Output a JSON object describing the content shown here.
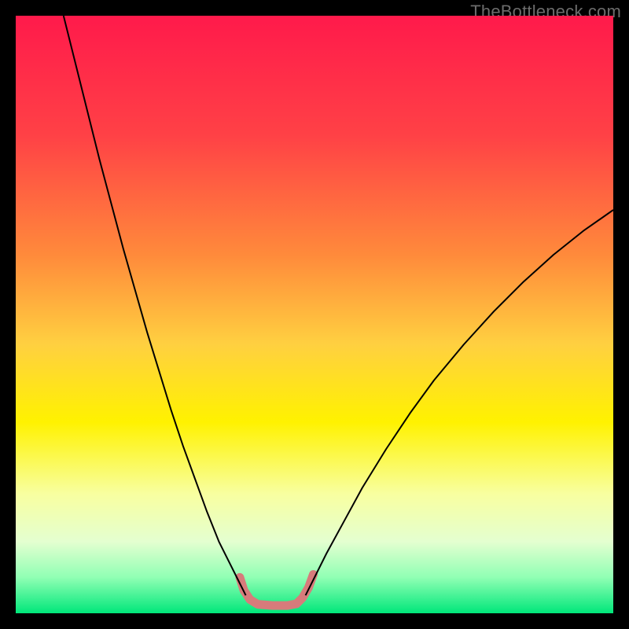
{
  "watermark": "TheBottleneck.com",
  "chart_data": {
    "type": "line",
    "title": "",
    "xlabel": "",
    "ylabel": "",
    "xlim": [
      0,
      100
    ],
    "ylim": [
      0,
      100
    ],
    "background_gradient": {
      "stops": [
        {
          "offset": 0.0,
          "color": "#ff1a4b"
        },
        {
          "offset": 0.2,
          "color": "#ff4146"
        },
        {
          "offset": 0.4,
          "color": "#ff8a3b"
        },
        {
          "offset": 0.55,
          "color": "#ffd040"
        },
        {
          "offset": 0.68,
          "color": "#fff200"
        },
        {
          "offset": 0.8,
          "color": "#f8ffa0"
        },
        {
          "offset": 0.88,
          "color": "#e4ffd0"
        },
        {
          "offset": 0.94,
          "color": "#90ffb4"
        },
        {
          "offset": 1.0,
          "color": "#00e77a"
        }
      ]
    },
    "series": [
      {
        "name": "left-curve",
        "stroke": "#000000",
        "stroke_width": 2,
        "points": [
          {
            "x": 8.0,
            "y": 100.0
          },
          {
            "x": 9.0,
            "y": 96.0
          },
          {
            "x": 10.0,
            "y": 92.0
          },
          {
            "x": 12.0,
            "y": 84.0
          },
          {
            "x": 14.0,
            "y": 76.0
          },
          {
            "x": 16.0,
            "y": 68.5
          },
          {
            "x": 18.0,
            "y": 61.0
          },
          {
            "x": 20.0,
            "y": 54.0
          },
          {
            "x": 22.0,
            "y": 47.0
          },
          {
            "x": 24.0,
            "y": 40.5
          },
          {
            "x": 26.0,
            "y": 34.0
          },
          {
            "x": 28.0,
            "y": 28.0
          },
          {
            "x": 30.0,
            "y": 22.5
          },
          {
            "x": 32.0,
            "y": 17.0
          },
          {
            "x": 34.0,
            "y": 12.0
          },
          {
            "x": 36.0,
            "y": 8.0
          },
          {
            "x": 37.5,
            "y": 5.0
          },
          {
            "x": 38.5,
            "y": 3.0
          }
        ]
      },
      {
        "name": "right-curve",
        "stroke": "#000000",
        "stroke_width": 2,
        "points": [
          {
            "x": 48.5,
            "y": 3.0
          },
          {
            "x": 50.0,
            "y": 6.0
          },
          {
            "x": 52.0,
            "y": 10.0
          },
          {
            "x": 55.0,
            "y": 15.5
          },
          {
            "x": 58.0,
            "y": 21.0
          },
          {
            "x": 62.0,
            "y": 27.5
          },
          {
            "x": 66.0,
            "y": 33.5
          },
          {
            "x": 70.0,
            "y": 39.0
          },
          {
            "x": 75.0,
            "y": 45.0
          },
          {
            "x": 80.0,
            "y": 50.5
          },
          {
            "x": 85.0,
            "y": 55.5
          },
          {
            "x": 90.0,
            "y": 60.0
          },
          {
            "x": 95.0,
            "y": 64.0
          },
          {
            "x": 100.0,
            "y": 67.5
          }
        ]
      },
      {
        "name": "bottom-highlight",
        "stroke": "#d77b7b",
        "stroke_width": 11,
        "linecap": "round",
        "points": [
          {
            "x": 37.5,
            "y": 6.0
          },
          {
            "x": 38.2,
            "y": 3.8
          },
          {
            "x": 39.2,
            "y": 2.3
          },
          {
            "x": 40.5,
            "y": 1.5
          },
          {
            "x": 43.0,
            "y": 1.3
          },
          {
            "x": 45.5,
            "y": 1.3
          },
          {
            "x": 47.0,
            "y": 1.6
          },
          {
            "x": 48.0,
            "y": 2.6
          },
          {
            "x": 49.0,
            "y": 4.3
          },
          {
            "x": 49.8,
            "y": 6.5
          }
        ]
      }
    ]
  }
}
